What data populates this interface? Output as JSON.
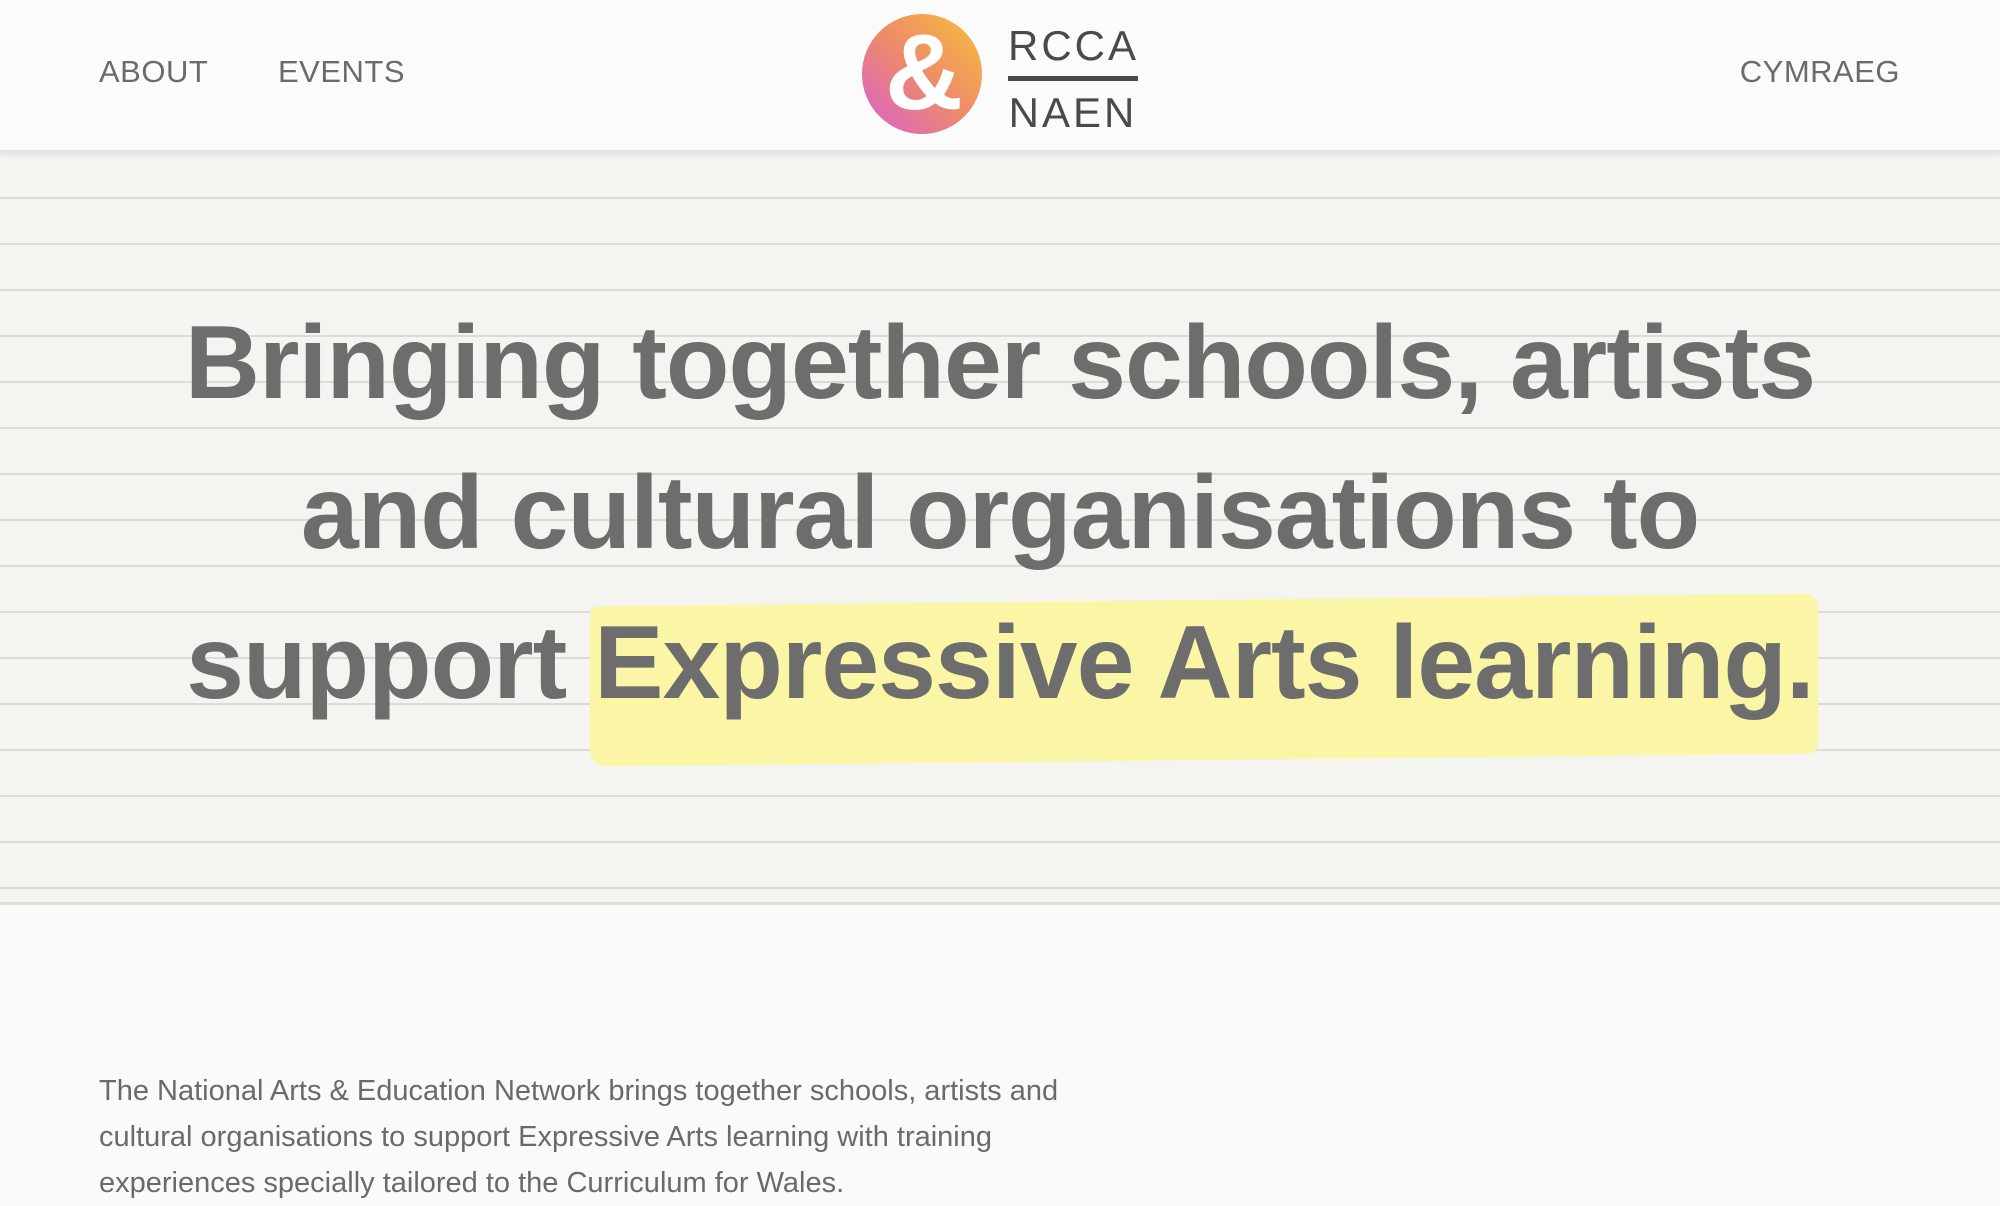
{
  "nav": {
    "about": "ABOUT",
    "events": "EVENTS",
    "language": "CYMRAEG"
  },
  "logo": {
    "top_text": "RCCA",
    "bottom_text": "NAEN",
    "icon": "ampersand-gradient-icon",
    "gradient_colors": [
      "#f5c23a",
      "#ee8a6a",
      "#d95fd0"
    ]
  },
  "hero": {
    "title_lead": "Bringing together schools, artists and cultural organisations to support",
    "title_highlight": "Expressive Arts learning.",
    "highlight_color": "#fbf6a6"
  },
  "intro": {
    "text": "The National Arts & Education Network brings together schools, artists and cultural organisations to support Expressive Arts learning with training experiences specially tailored to the Curriculum for Wales."
  }
}
